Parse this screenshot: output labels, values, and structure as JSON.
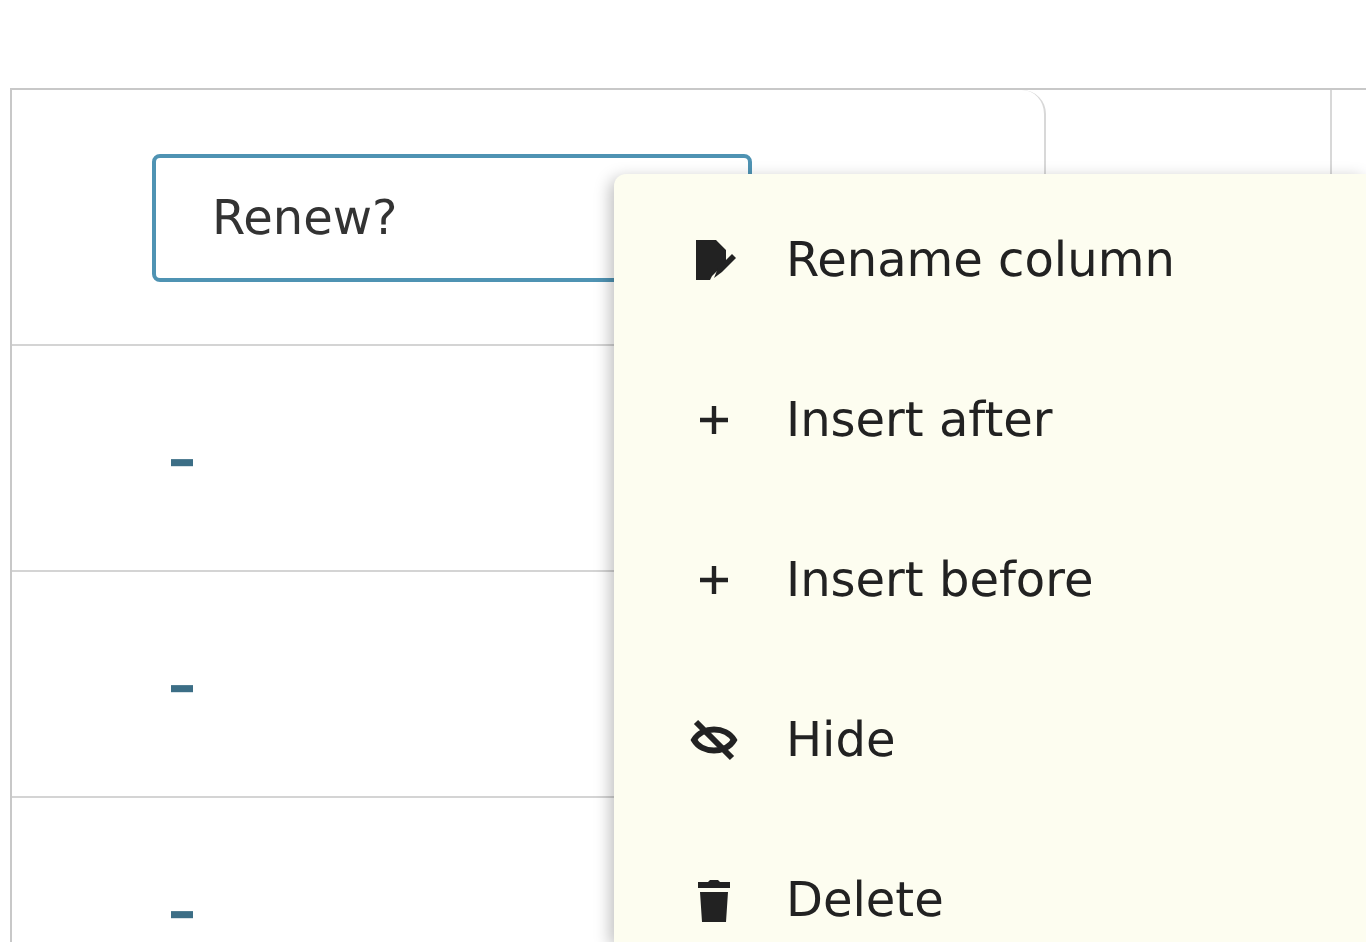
{
  "column_header": {
    "name_field": {
      "value": "Renew?"
    }
  },
  "rows": [
    {
      "cell": "–"
    },
    {
      "cell": "–"
    },
    {
      "cell": "–"
    }
  ],
  "context_menu": {
    "items": [
      {
        "label": "Rename column",
        "kind": "rename"
      },
      {
        "label": "Insert after",
        "kind": "insert"
      },
      {
        "label": "Insert before",
        "kind": "insert"
      },
      {
        "label": "Hide",
        "kind": "hide"
      },
      {
        "label": "Delete",
        "kind": "delete"
      }
    ]
  }
}
